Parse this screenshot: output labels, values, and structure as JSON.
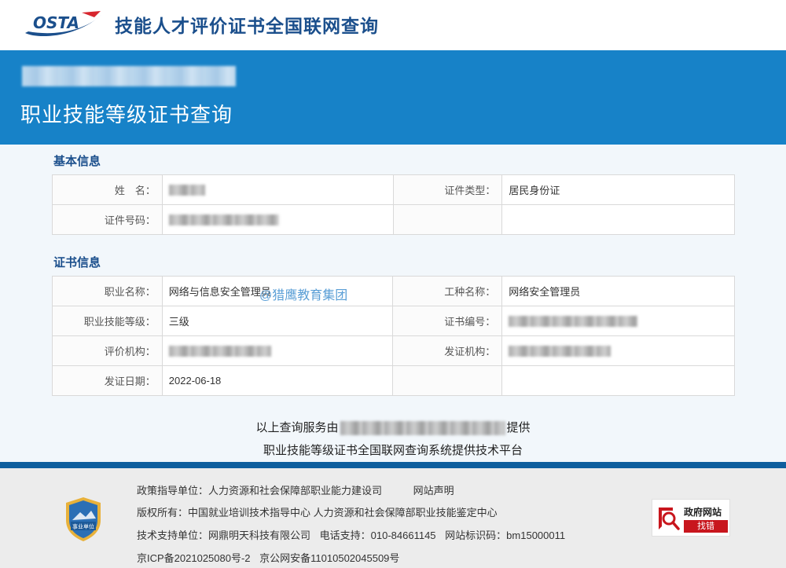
{
  "header": {
    "logo_text": "OSTA",
    "site_title": "技能人才评价证书全国联网查询"
  },
  "banner": {
    "title": "职业技能等级证书查询"
  },
  "basic_info": {
    "section_title": "基本信息",
    "rows": [
      {
        "label1": "姓　名：",
        "value1": "",
        "label2": "证件类型：",
        "value2": "居民身份证"
      },
      {
        "label1": "证件号码：",
        "value1": "",
        "label2": "",
        "value2": ""
      }
    ]
  },
  "cert_info": {
    "section_title": "证书信息",
    "rows": [
      {
        "label1": "职业名称：",
        "value1": "网络与信息安全管理员",
        "label2": "工种名称：",
        "value2": "网络安全管理员"
      },
      {
        "label1": "职业技能等级：",
        "value1": "三级",
        "label2": "证书编号：",
        "value2": ""
      },
      {
        "label1": "评价机构：",
        "value1": "",
        "label2": "发证机构：",
        "value2": ""
      },
      {
        "label1": "发证日期：",
        "value1": "2022-06-18",
        "label2": "",
        "value2": ""
      }
    ]
  },
  "watermark": "@猎鹰教育集团",
  "provided": {
    "prefix": "以上查询服务由",
    "suffix": "提供",
    "line2": "职业技能等级证书全国联网查询系统提供技术平台"
  },
  "footer": {
    "badge_text": "事业单位",
    "line1": "政策指导单位：人力资源和社会保障部职业能力建设司",
    "line1_link": "网站声明",
    "line2": "版权所有：中国就业培训技术指导中心  人力资源和社会保障部职业技能鉴定中心",
    "line3_tech": "技术支持单位：网鼎明天科技有限公司",
    "line3_phone": "电话支持：010-84661145",
    "line3_id": "网站标识码：bm15000011",
    "line4_icp": "京ICP备2021025080号-2",
    "line4_police": "京公网安备11010502045509号",
    "gov_title": "政府网站",
    "gov_button": "找错"
  },
  "colors": {
    "brand_blue": "#1782c8",
    "title_blue": "#1b4f8c",
    "gov_red": "#c8161d"
  }
}
